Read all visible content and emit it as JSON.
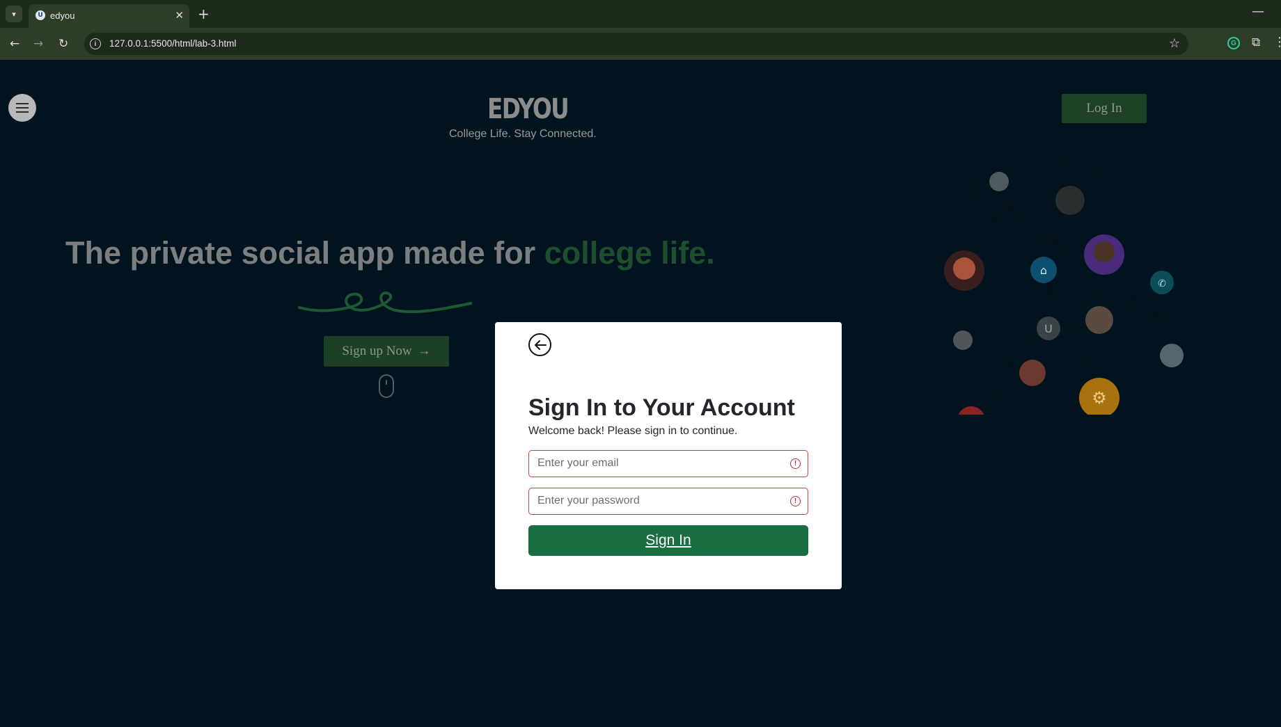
{
  "browser": {
    "tab_title": "edyou",
    "tab_favicon": "U",
    "url": "127.0.0.1:5500/html/lab-3.html",
    "icons": [
      "tab-list-icon",
      "close-icon",
      "new-tab-icon",
      "minimize-icon",
      "back-icon",
      "forward-icon",
      "reload-icon",
      "site-info-icon",
      "star-icon",
      "grammarly-icon",
      "extensions-icon"
    ]
  },
  "header": {
    "logo": "EDYOU",
    "tagline": "College Life. Stay Connected.",
    "login_label": "Log In"
  },
  "hero": {
    "headline_main": "The private social app made for ",
    "headline_accent": "college life.",
    "signup_label": "Sign up Now",
    "signup_arrow": "→"
  },
  "modal": {
    "title": "Sign In to Your Account",
    "subtitle": "Welcome back! Please sign in to continue.",
    "email_placeholder": "Enter your email",
    "password_placeholder": "Enter your password",
    "submit_label": "Sign In",
    "alert_glyph": "!"
  },
  "colors": {
    "page_bg": "#01131e",
    "brand_green": "#1b6e41",
    "error_red": "#d23a47",
    "overlay_green": "#1e4125"
  }
}
